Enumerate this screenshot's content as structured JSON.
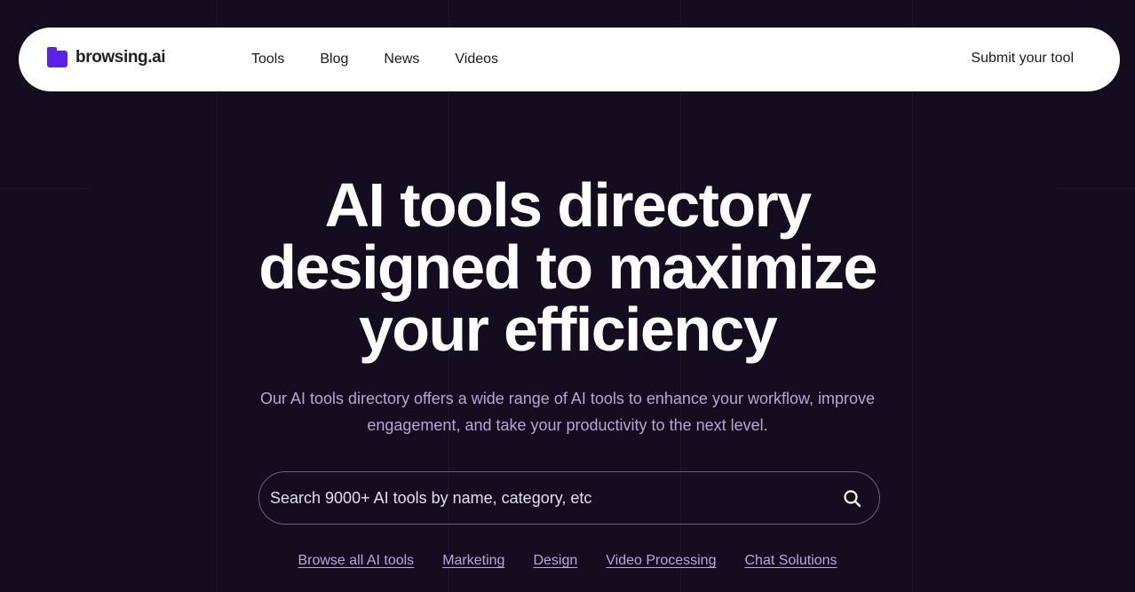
{
  "brand": {
    "name": "browsing.ai",
    "accent_color": "#5b21e6",
    "icon": "folder-icon"
  },
  "nav": {
    "links": [
      "Tools",
      "Blog",
      "News",
      "Videos"
    ],
    "submit_label": "Submit your tool"
  },
  "hero": {
    "title_lines": [
      "AI tools directory",
      "designed to maximize",
      "your efficiency"
    ],
    "subtitle_lines": [
      "Our AI tools directory offers a wide range of AI tools to enhance your workflow, improve",
      "engagement, and take your productivity to the next level."
    ]
  },
  "search": {
    "placeholder": "Search 9000+ AI tools by name, category, etc",
    "value": "",
    "icon": "search-icon"
  },
  "quick_links": [
    "Browse all AI tools",
    "Marketing",
    "Design",
    "Video Processing",
    "Chat Solutions"
  ],
  "colors": {
    "background": "#140c1f",
    "navbar": "#ffffff",
    "subtitle": "#b6a6d4",
    "link": "#b8a8db"
  }
}
